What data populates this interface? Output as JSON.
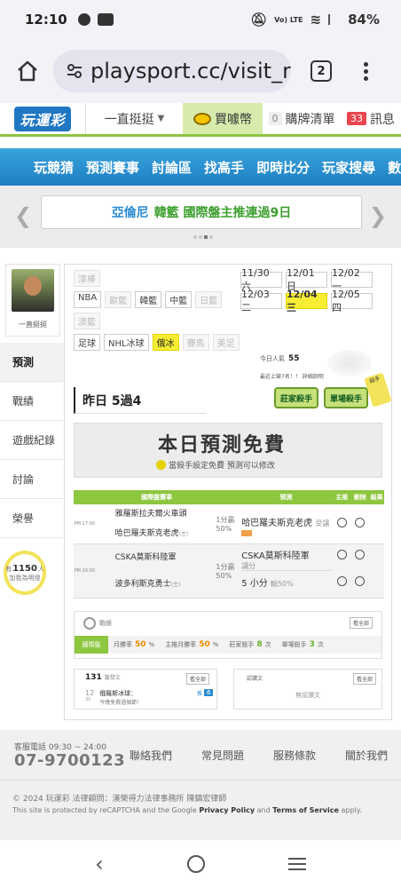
{
  "status": {
    "time": "12:10",
    "battery": "84%",
    "network": "Vo) LTE"
  },
  "browser": {
    "url": "playsport.cc/visit_m",
    "tab_count": "2",
    "icons": [
      "home-icon",
      "tune-icon",
      "tabs-icon",
      "more-vert-icon"
    ]
  },
  "site_header": {
    "logo": "玩運彩",
    "user": "一直挺挺",
    "coin": "買噱幣",
    "list_count": "0",
    "list_label": "購牌清單",
    "msg_count": "33",
    "msg_label": "訊息"
  },
  "nav": [
    "玩競猜",
    "預測賽事",
    "討論區",
    "找高手",
    "即時比分",
    "玩家搜尋",
    "數據"
  ],
  "announcement": {
    "part1": "亞倫尼",
    "part2": "韓籃 國際盤主推連過9日"
  },
  "profile": {
    "name": "一直挺挺"
  },
  "side_tabs": [
    "預測",
    "戰績",
    "遊戲紀錄",
    "討論",
    "榮譽"
  ],
  "hit": {
    "prefix": "有",
    "count": "1150",
    "suffix": "人",
    "line2": "加我為明燈"
  },
  "leagues": {
    "rows": [
      [
        {
          "label": "漆棒",
          "state": "dim"
        }
      ],
      [
        {
          "label": "NBA",
          "state": "on"
        },
        {
          "label": "歐籃",
          "state": "dim"
        },
        {
          "label": "韓籃",
          "state": "on"
        },
        {
          "label": "中籃",
          "state": "on"
        },
        {
          "label": "日籃",
          "state": "dim"
        }
      ],
      [
        {
          "label": "澳籃",
          "state": "dim"
        }
      ],
      [
        {
          "label": "足球",
          "state": "on"
        },
        {
          "label": "NHL冰球",
          "state": "on"
        },
        {
          "label": "俄冰",
          "state": "sel"
        },
        {
          "label": "賽馬",
          "state": "dim"
        },
        {
          "label": "美足",
          "state": "dim"
        }
      ]
    ]
  },
  "dates": [
    {
      "label": "11/30 六",
      "sel": false
    },
    {
      "label": "12/01 日",
      "sel": false
    },
    {
      "label": "12/02 一",
      "sel": false
    },
    {
      "label": "12/03 二",
      "sel": false
    },
    {
      "label": "12/04 三",
      "sel": true
    },
    {
      "label": "12/05 四",
      "sel": false
    }
  ],
  "popularity": {
    "label": "今日人氣",
    "value": "55",
    "rank_text": "最近上榮7名！！ 詳細說明"
  },
  "badges": {
    "b1": "莊家殺手",
    "b2": "單場殺手",
    "flag": "殺手"
  },
  "yesterday": "昨日 5過4",
  "free": {
    "title": "本日預測免費",
    "subtitle": "當殺手設定免費 預測可以修改"
  },
  "table": {
    "headers": [
      "國際盤賽事",
      "預測",
      "主推",
      "刪除",
      "結果"
    ],
    "games": [
      {
        "time": "PM 17:00",
        "team1": "雅羅斯拉夫爾火車頭",
        "team2": "哈巴羅夫斯克老虎",
        "team2_mark": "(主)",
        "line": "1分贏",
        "pct": "50%",
        "pick": "哈巴羅夫斯克老虎",
        "pick_sub": "受讓",
        "pick2": "",
        "pick2_sub": ""
      },
      {
        "time": "PM 20:00",
        "team1": "CSKA莫斯科陸軍",
        "team2": "波多利斯克勇士",
        "team2_mark": "(主)",
        "line": "1分贏",
        "pct": "50%",
        "pick": "CSKA莫斯科陸軍",
        "pick_sub": "讓分",
        "pick2": "5 小分",
        "pick2_sub": "輸50%"
      }
    ]
  },
  "stats": {
    "header": "戰績",
    "all": "看全部",
    "tab": "國際盤",
    "month_label": "月勝率",
    "month_value": "50",
    "main_month_label": "主推月勝率",
    "main_month_value": "50",
    "bank_label": "莊家殺手",
    "bank_value": "8",
    "single_label": "單場殺手",
    "single_value": "3",
    "pct": "%",
    "unit": "次"
  },
  "forum": {
    "count": "131",
    "count_label": "篇發文",
    "all": "看全部",
    "num": "12",
    "num_sub": "30",
    "title": "俄羅斯冰球：",
    "subtitle": "今晚免費過個節！",
    "label": "推",
    "badge": "6"
  },
  "forum2": {
    "header": "認讚文",
    "all": "看全部",
    "empty": "無認讚文"
  },
  "footer": {
    "hotline_label": "客服電話 09:30 ~ 24:00",
    "hotline": "07-9700123",
    "links": [
      "聯絡我們",
      "常見問題",
      "服務條款",
      "關於我們"
    ],
    "copyright": "© 2024 玩運彩 法律顧問：漢榮得力法律事務所 陳鎮宏律師",
    "recaptcha_prefix": "This site is protected by reCAPTCHA and the Google",
    "privacy": "Privacy Policy",
    "and": "and",
    "terms": "Terms of Service",
    "apply": "apply."
  }
}
